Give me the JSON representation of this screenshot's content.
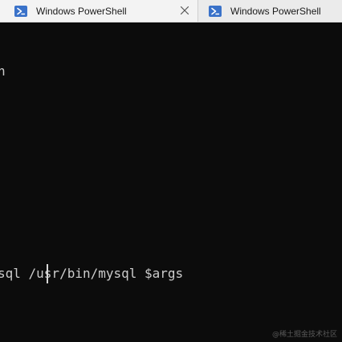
{
  "tabs": [
    {
      "title": "Windows PowerShell",
      "icon": "powershell-icon",
      "active": true,
      "close_icon": "close-icon"
    },
    {
      "title": "Windows PowerShell",
      "icon": "powershell-icon",
      "active": false
    }
  ],
  "terminal": {
    "lines": [
      "h",
      "sql /usr/bin/mysql $args"
    ]
  },
  "watermark": "@稀土掘金技术社区",
  "colors": {
    "terminal_bg": "#0c0c0c",
    "terminal_fg": "#cccccc",
    "tabbar_bg": "#f3f3f3",
    "powershell_icon": "#3a72c9"
  }
}
